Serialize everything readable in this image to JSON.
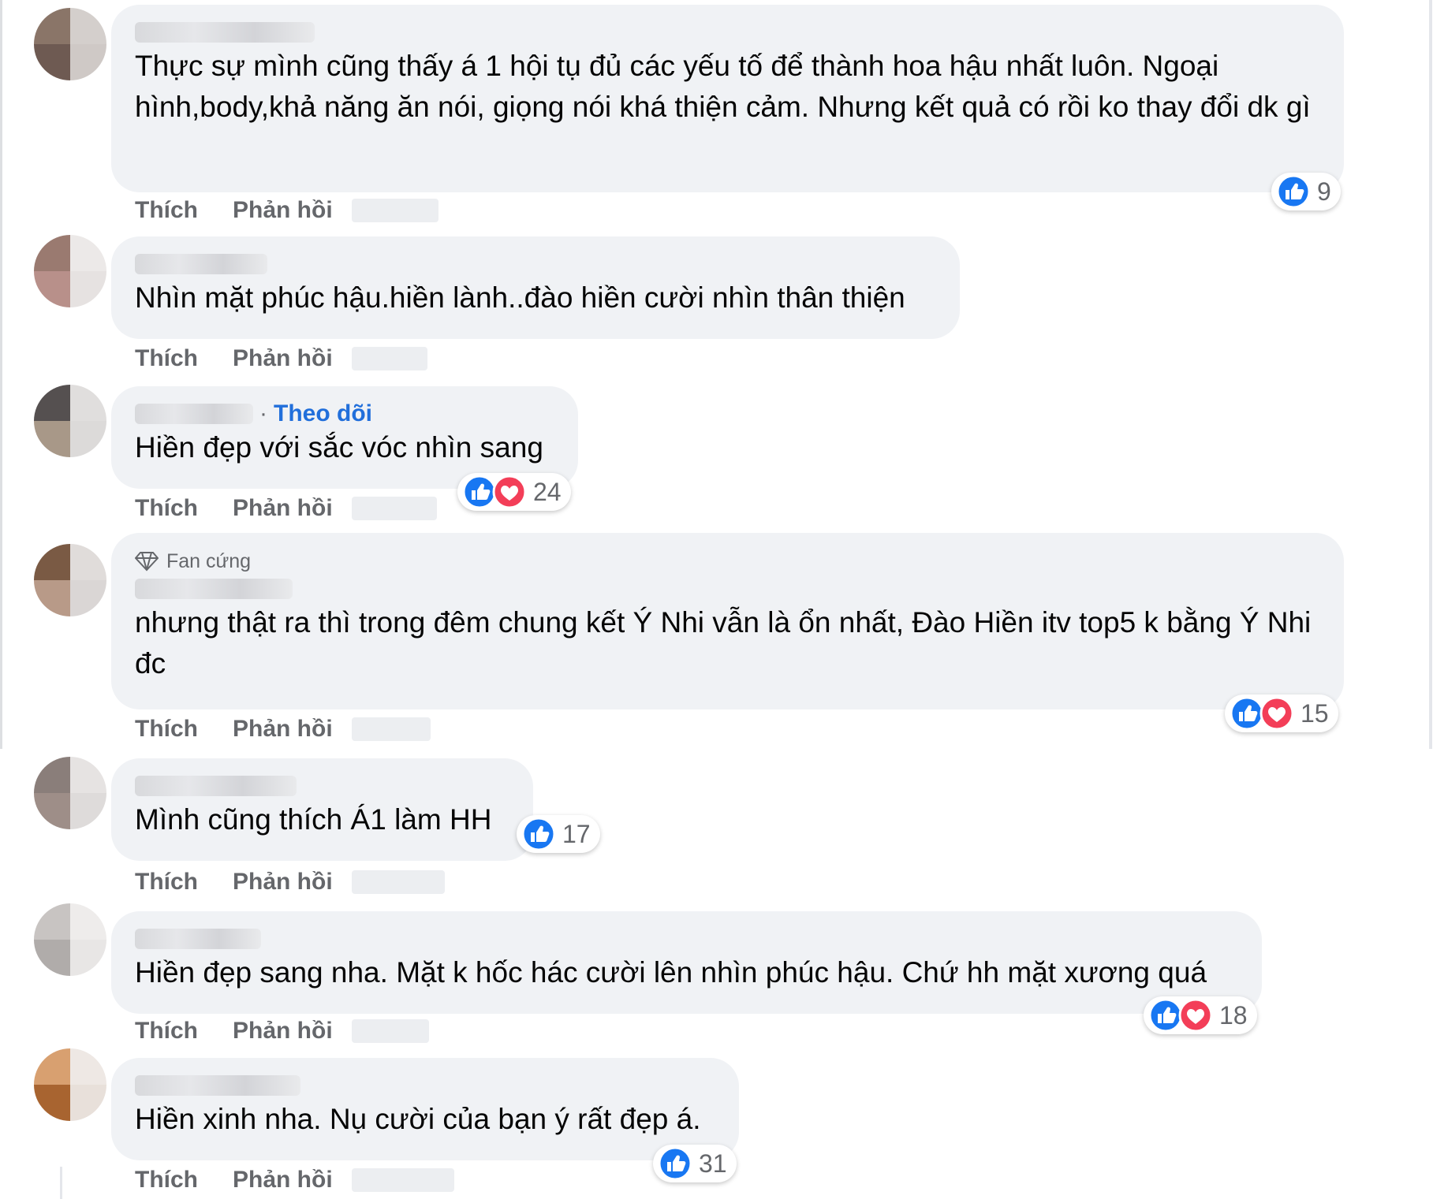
{
  "labels": {
    "like": "Thích",
    "reply": "Phản hồi"
  },
  "colors": {
    "accent": "#216fdb",
    "bubble": "#f0f2f5",
    "like_blue": "#1877f2",
    "love_red": "#f33e58"
  },
  "comments": [
    {
      "text": "Thực sự mình cũng thấy á 1 hội tụ đủ các yếu tố để thành hoa hậu nhất luôn. Ngoại hình,body,khả năng ăn nói, giọng nói khá thiện cảm. Nhưng kết quả có rồi ko thay đổi dk gì",
      "reactions": [
        "like"
      ],
      "reaction_count": "9"
    },
    {
      "text": "Nhìn mặt phúc hậu.hiền lành..đào hiền cười nhìn thân thiện",
      "reactions": [],
      "reaction_count": ""
    },
    {
      "follow": "Theo dõi",
      "text": "Hiền đẹp với sắc vóc nhìn sang",
      "reactions": [
        "like",
        "love"
      ],
      "reaction_count": "24"
    },
    {
      "badge": "Fan cứng",
      "text": "nhưng thật ra thì trong đêm chung kết Ý Nhi vẫn là ổn nhất, Đào Hiền itv top5 k bằng Ý Nhi đc",
      "reactions": [
        "like",
        "love"
      ],
      "reaction_count": "15"
    },
    {
      "text": "Mình cũng thích Á1 làm HH",
      "reactions": [
        "like"
      ],
      "reaction_count": "17"
    },
    {
      "text": "Hiền đẹp sang nha. Mặt k hốc hác cười lên nhìn phúc hậu. Chứ hh mặt xương quá",
      "reactions": [
        "like",
        "love"
      ],
      "reaction_count": "18"
    },
    {
      "text": "Hiền xinh nha. Nụ cười của bạn ý rất đẹp á.",
      "reactions": [
        "like"
      ],
      "reaction_count": "31"
    }
  ]
}
